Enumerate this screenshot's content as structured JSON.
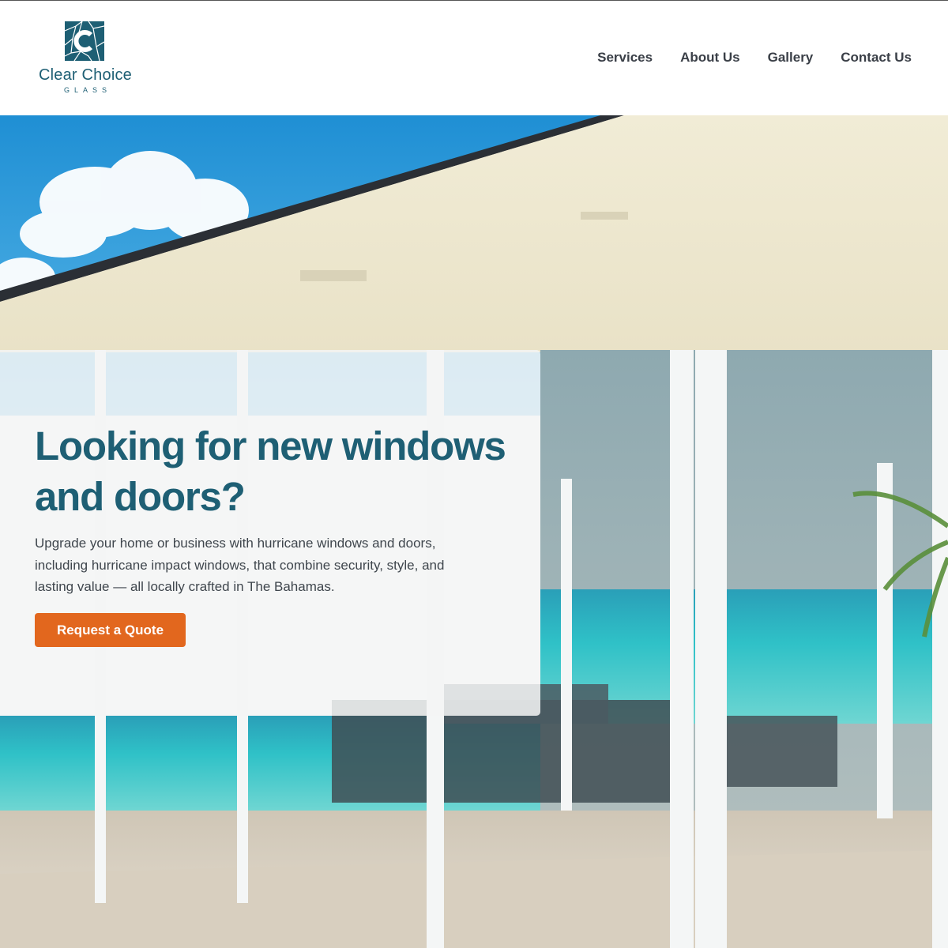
{
  "brand": {
    "name": "Clear Choice",
    "tagline": "GLASS",
    "logo_icon": "stained-glass-c-logo",
    "color": "#1e5f74"
  },
  "nav": {
    "items": [
      {
        "label": "Services"
      },
      {
        "label": "About Us"
      },
      {
        "label": "Gallery"
      },
      {
        "label": "Contact Us"
      }
    ]
  },
  "hero": {
    "title": "Looking for new windows and doors?",
    "text": "Upgrade your home or business with hurricane windows and doors, including hurricane impact windows, that combine security, style, and lasting value — all locally crafted in The Bahamas.",
    "cta_label": "Request a Quote",
    "cta_color": "#e2671e",
    "background": "beachfront-house-glass-doors-photo"
  }
}
